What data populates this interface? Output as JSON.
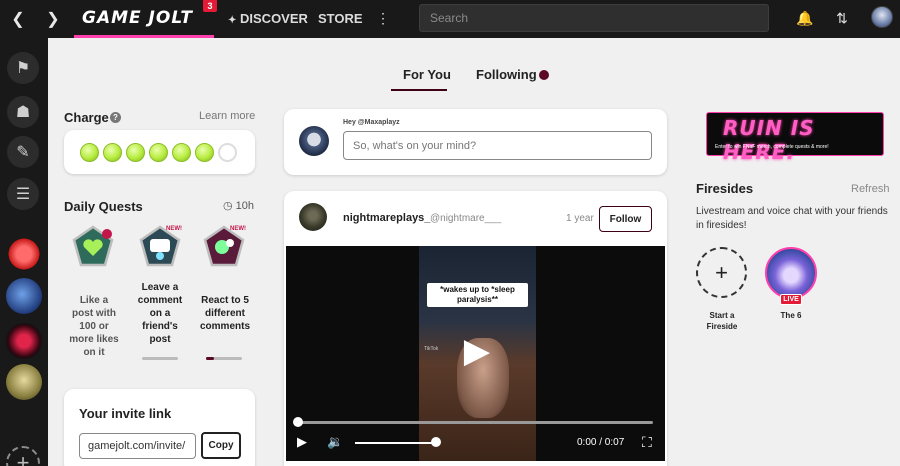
{
  "topbar": {
    "logo": "GAME JOLT",
    "logo_badge": "3",
    "nav_discover": "DISCOVER",
    "nav_store": "STORE",
    "search_placeholder": "Search"
  },
  "feed_tabs": {
    "for_you": "For You",
    "following": "Following"
  },
  "charge": {
    "title": "Charge",
    "learn_more": "Learn more",
    "filled": 6,
    "total": 7
  },
  "daily_quests": {
    "title": "Daily Quests",
    "time_left": "10h",
    "quests": [
      {
        "text": "Like a post with 100 or more likes on it",
        "badge": ""
      },
      {
        "text": "Leave a comment on a friend's post",
        "badge": "NEW!"
      },
      {
        "text": "React to 5 different comments",
        "badge": "NEW!"
      }
    ]
  },
  "invite": {
    "title": "Your invite link",
    "link": "gamejolt.com/invite/",
    "copy_label": "Copy"
  },
  "compose": {
    "greeting": "Hey @Maxaplayz",
    "placeholder": "So, what's on your mind?"
  },
  "post": {
    "username": "nightmareplays_",
    "handle": "@nightmare___",
    "time": "1 year",
    "follow_label": "Follow",
    "video_caption": "*wakes up to *sleep paralysis**",
    "video_watermark": "TikTok",
    "video_time": "0:00 / 0:07"
  },
  "promo": {
    "title": "RUIN IS HERE.",
    "subtitle": "Enter to win FNaF merch, complete quests & more!"
  },
  "firesides": {
    "title": "Firesides",
    "refresh": "Refresh",
    "description": "Livestream and voice chat with your friends in firesides!",
    "start_label": "Start a Fireside",
    "items": [
      {
        "name": "The 6",
        "badge": "LIVE"
      }
    ]
  },
  "colors": {
    "accent_pink": "#ff3fac",
    "tab_underline": "#3d0016",
    "live_red": "#e31b37",
    "charge_green": "#b6ec3e"
  }
}
